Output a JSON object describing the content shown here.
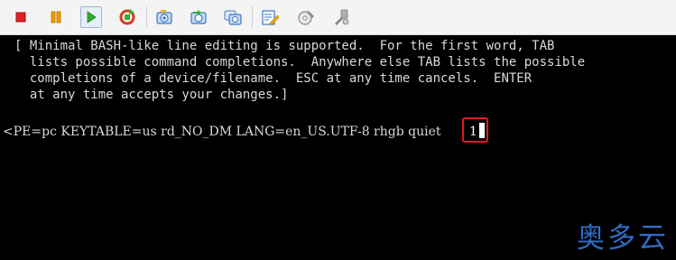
{
  "toolbar": {
    "buttons": [
      {
        "icon": "stop-icon",
        "color": "#e02020"
      },
      {
        "icon": "pause-icon",
        "color": "#f0a000"
      },
      {
        "icon": "play-icon",
        "color": "#2fb12f"
      },
      {
        "icon": "restart-icon",
        "color": "#d83a1e"
      },
      {
        "icon": "snapshot-icon",
        "color": "#3a78c8"
      },
      {
        "icon": "revert-snapshot-icon",
        "color": "#3a78c8"
      },
      {
        "icon": "snapshot-manager-icon",
        "color": "#3a78c8"
      },
      {
        "icon": "edit-settings-icon",
        "color": "#3a78c8"
      },
      {
        "icon": "connect-cd-icon",
        "color": "#8a8a8a"
      },
      {
        "icon": "tools-icon",
        "color": "#8a8a8a"
      }
    ]
  },
  "console": {
    "help_lines": [
      "[ Minimal BASH-like line editing is supported.  For the first word, TAB",
      "  lists possible command completions.  Anywhere else TAB lists the possible",
      "  completions of a device/filename.  ESC at any time cancels.  ENTER",
      "  at any time accepts your changes.]"
    ],
    "command_line": "<PE=pc KEYTABLE=us rd_NO_DM LANG=en_US.UTF-8 rhgb quiet ",
    "entered_value": "1",
    "highlight_color": "#e01a1a"
  },
  "watermark": {
    "text": "奥多云",
    "color": "#2f6cc4"
  }
}
